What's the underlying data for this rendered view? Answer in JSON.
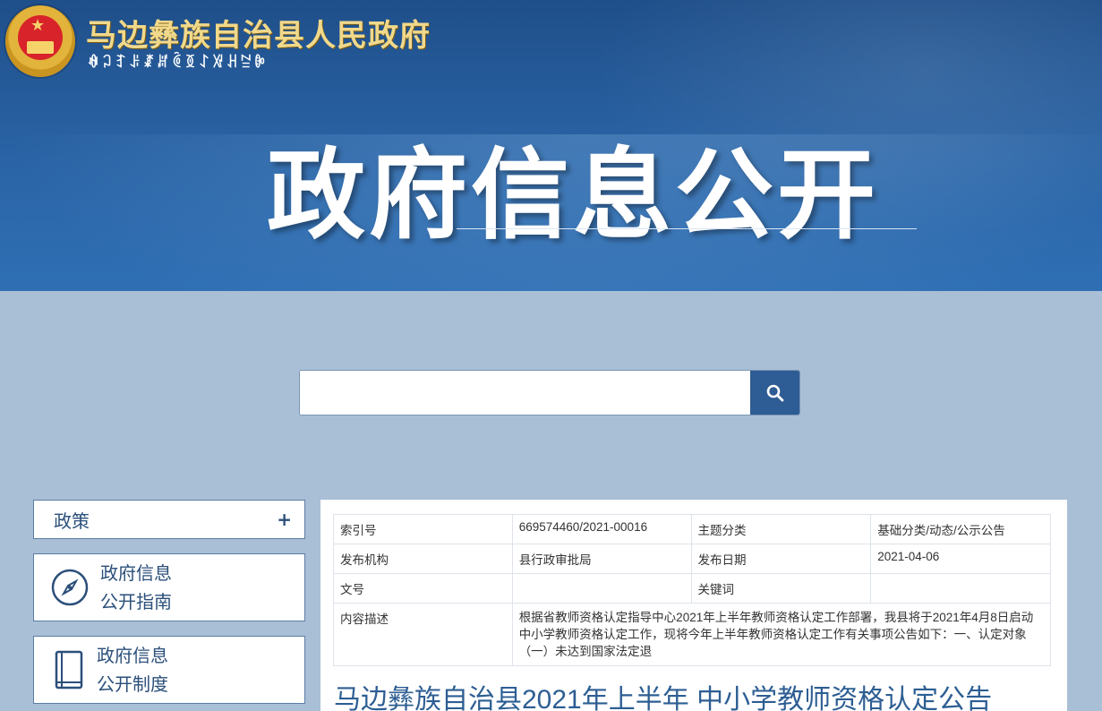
{
  "header": {
    "site_title": "马边彝族自治县人民政府",
    "site_subtitle": "ꊿꃀꆈꌠꊨꏦꏱꅉꋍꑟꃅꊂꐊ",
    "banner_heading": "政府信息公开"
  },
  "search": {
    "placeholder": "",
    "icon": "search-icon"
  },
  "sidebar": {
    "policy_label": "政策",
    "policy_toggle": "+",
    "guide_label_line1": "政府信息",
    "guide_label_line2": "公开指南",
    "guide_icon": "compass-icon",
    "system_label_line1": "政府信息",
    "system_label_line2": "公开制度",
    "system_icon": "book-icon"
  },
  "meta": {
    "index_key": "索引号",
    "index_value": "669574460/2021-00016",
    "topic_key": "主题分类",
    "topic_value": "基础分类/动态/公示公告",
    "org_key": "发布机构",
    "org_value": "县行政审批局",
    "date_key": "发布日期",
    "date_value": "2021-04-06",
    "docno_key": "文号",
    "docno_value": "",
    "keywords_key": "关键词",
    "keywords_value": "",
    "desc_key": "内容描述",
    "desc_value": "根据省教师资格认定指导中心2021年上半年教师资格认定工作部署，我县将于2021年4月8日启动中小学教师资格认定工作，现将今年上半年教师资格认定工作有关事项公告如下：一、认定对象（一）未达到国家法定退"
  },
  "article": {
    "title": "马边彝族自治县2021年上半年 中小学教师资格认定公告"
  }
}
